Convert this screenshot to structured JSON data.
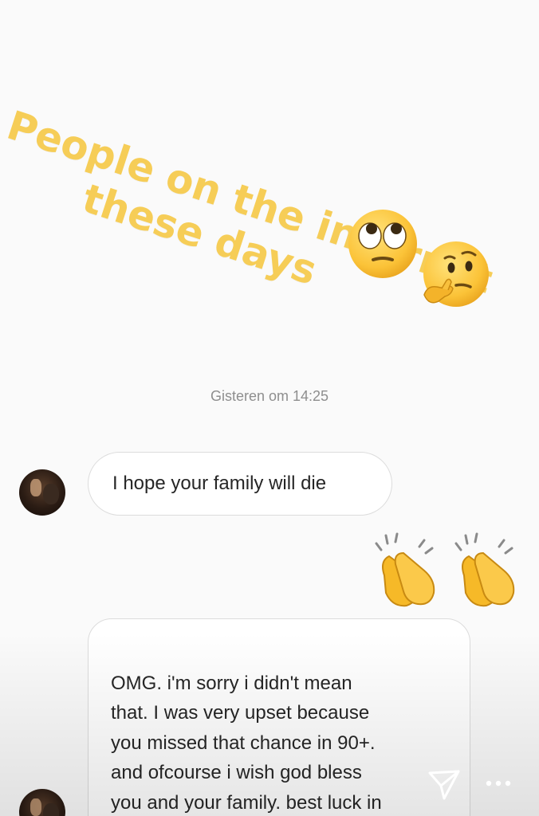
{
  "story": {
    "caption_line1": "People on the internet",
    "caption_line2": "these days",
    "caption_color": "#f6cd57",
    "emojis": [
      "face-with-rolling-eyes",
      "thinking-face"
    ]
  },
  "chat": {
    "timestamp": "Gisteren om 14:25",
    "messages": [
      {
        "sender": "other",
        "text": "I hope your family will die"
      },
      {
        "sender": "self",
        "type": "emoji",
        "emoji": [
          "clapping-hands",
          "clapping-hands"
        ]
      },
      {
        "sender": "other",
        "text": "OMG.  i'm sorry i didn't mean\nthat. I was very upset because\nyou missed that chance in 90+.\nand ofcourse i wish god bless\nyou and your family. best luck in\nfuture"
      }
    ]
  },
  "controls": {
    "send_icon": "send-paper-plane-icon",
    "more_icon": "more-options-icon"
  }
}
